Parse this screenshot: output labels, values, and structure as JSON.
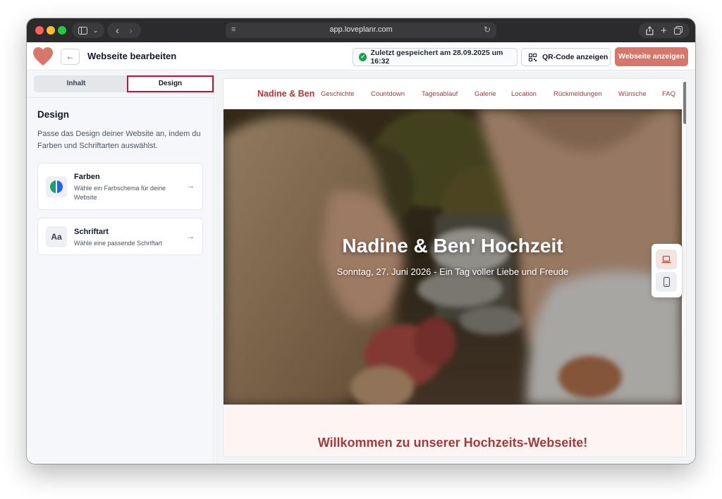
{
  "browser": {
    "url": "app.loveplanr.com"
  },
  "header": {
    "title": "Webseite bearbeiten",
    "save_status": "Zuletzt gespeichert am 28.09.2025 um 16:32",
    "qr_button": "QR-Code anzeigen",
    "view_button": "Webseite anzeigen"
  },
  "sidebar": {
    "tabs": [
      {
        "label": "Inhalt",
        "active": false
      },
      {
        "label": "Design",
        "active": true
      }
    ],
    "section_title": "Design",
    "section_description": "Passe das Design deiner Website an, indem du Farben und Schriftarten auswählst.",
    "cards": [
      {
        "title": "Farben",
        "subtitle": "Wähle ein Farbschema für deine Website",
        "icon": "palette-icon"
      },
      {
        "title": "Schriftart",
        "subtitle": "Wähle eine passende Schriftart",
        "icon_text": "Aa"
      }
    ]
  },
  "preview": {
    "brand": "Nadine & Ben",
    "nav": [
      "Geschichte",
      "Countdown",
      "Tagesablauf",
      "Galerie",
      "Location",
      "Rückmeldungen",
      "Wünsche",
      "FAQ"
    ],
    "hero_title": "Nadine & Ben' Hochzeit",
    "hero_subtitle": "Sonntag, 27. Juni 2026 - Ein Tag voller Liebe und Freude",
    "welcome_title": "Willkommen zu unserer Hochzeits-Webseite!",
    "device_toggle": {
      "selected": "desktop"
    }
  },
  "colors": {
    "accent": "#d9766a",
    "brand_red": "#a63a3a",
    "tab_highlight": "#c8102e",
    "success": "#16a34a"
  }
}
